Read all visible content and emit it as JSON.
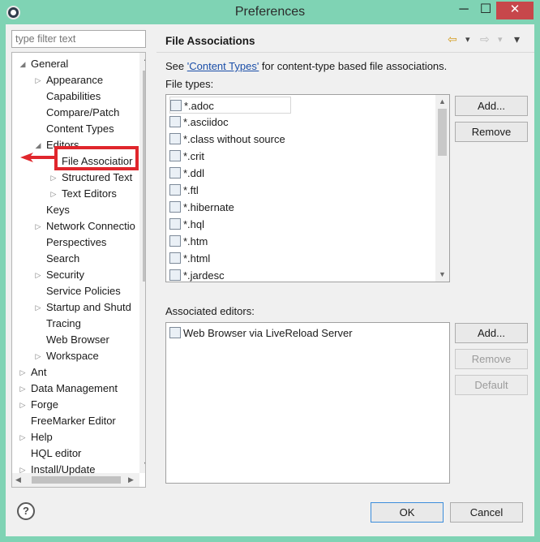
{
  "window": {
    "title": "Preferences",
    "controls": {
      "minimize": "─",
      "maximize": "☐",
      "close": "✕"
    }
  },
  "filter": {
    "placeholder": "type filter text"
  },
  "tree": {
    "items": [
      {
        "label": "General",
        "level": 0,
        "twisty": "◢"
      },
      {
        "label": "Appearance",
        "level": 1,
        "twisty": "▷"
      },
      {
        "label": "Capabilities",
        "level": 1,
        "twisty": ""
      },
      {
        "label": "Compare/Patch",
        "level": 1,
        "twisty": ""
      },
      {
        "label": "Content Types",
        "level": 1,
        "twisty": ""
      },
      {
        "label": "Editors",
        "level": 1,
        "twisty": "◢"
      },
      {
        "label": "File Associatior",
        "level": 2,
        "twisty": ""
      },
      {
        "label": "Structured Text",
        "level": 2,
        "twisty": "▷"
      },
      {
        "label": "Text Editors",
        "level": 2,
        "twisty": "▷"
      },
      {
        "label": "Keys",
        "level": 1,
        "twisty": ""
      },
      {
        "label": "Network Connectio",
        "level": 1,
        "twisty": "▷"
      },
      {
        "label": "Perspectives",
        "level": 1,
        "twisty": ""
      },
      {
        "label": "Search",
        "level": 1,
        "twisty": ""
      },
      {
        "label": "Security",
        "level": 1,
        "twisty": "▷"
      },
      {
        "label": "Service Policies",
        "level": 1,
        "twisty": ""
      },
      {
        "label": "Startup and Shutd",
        "level": 1,
        "twisty": "▷"
      },
      {
        "label": "Tracing",
        "level": 1,
        "twisty": ""
      },
      {
        "label": "Web Browser",
        "level": 1,
        "twisty": ""
      },
      {
        "label": "Workspace",
        "level": 1,
        "twisty": "▷"
      },
      {
        "label": "Ant",
        "level": 0,
        "twisty": "▷"
      },
      {
        "label": "Data Management",
        "level": 0,
        "twisty": "▷"
      },
      {
        "label": "Forge",
        "level": 0,
        "twisty": "▷"
      },
      {
        "label": "FreeMarker Editor",
        "level": 0,
        "twisty": ""
      },
      {
        "label": "Help",
        "level": 0,
        "twisty": "▷"
      },
      {
        "label": "HQL editor",
        "level": 0,
        "twisty": ""
      },
      {
        "label": "Install/Update",
        "level": 0,
        "twisty": "▷"
      }
    ],
    "selected_label": "File Associatior"
  },
  "panel": {
    "title": "File Associations",
    "nav": {
      "back": "⇦",
      "back_menu": "▾",
      "forward": "⇨",
      "forward_menu": "▾",
      "view_menu": "▾"
    },
    "description_prefix": "See ",
    "description_link": "'Content Types'",
    "description_suffix": " for content-type based file associations.",
    "file_types_label": "File types:",
    "file_types": [
      {
        "name": "*.adoc",
        "icon": "plugin-file-icon"
      },
      {
        "name": "*.asciidoc",
        "icon": "plugin-file-icon"
      },
      {
        "name": "*.class without source",
        "icon": "binary-file-icon"
      },
      {
        "name": "*.crit",
        "icon": "crit-file-icon"
      },
      {
        "name": "*.ddl",
        "icon": "ddl-file-icon"
      },
      {
        "name": "*.ftl",
        "icon": "ftl-file-icon"
      },
      {
        "name": "*.hibernate",
        "icon": "hibernate-file-icon"
      },
      {
        "name": "*.hql",
        "icon": "hql-file-icon"
      },
      {
        "name": "*.htm",
        "icon": "text-file-icon"
      },
      {
        "name": "*.html",
        "icon": "text-file-icon"
      },
      {
        "name": "*.jardesc",
        "icon": "jardesc-file-icon"
      }
    ],
    "file_buttons": {
      "add": "Add...",
      "remove": "Remove"
    },
    "editors_label": "Associated editors:",
    "editors": [
      {
        "name": "Web Browser via LiveReload Server",
        "icon": "plugin-file-icon"
      }
    ],
    "editor_buttons": {
      "add": "Add...",
      "remove": "Remove",
      "default": "Default"
    }
  },
  "footer": {
    "help": "?",
    "ok": "OK",
    "cancel": "Cancel"
  },
  "colors": {
    "frame": "#7fd3b4",
    "highlight_box": "#e0262c",
    "link": "#1a4ea8",
    "close_button": "#c7474b"
  }
}
